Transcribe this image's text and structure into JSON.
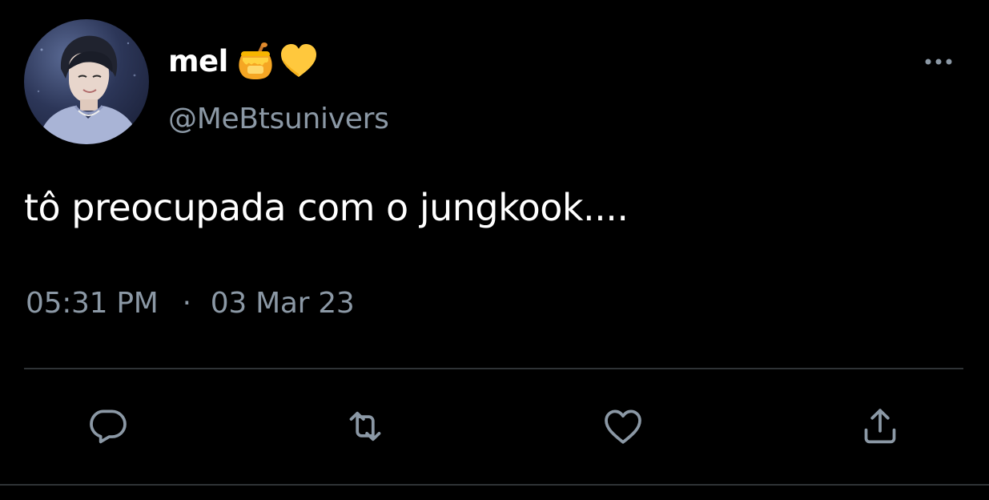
{
  "tweet": {
    "author": {
      "display_name": "mel",
      "name_emojis": [
        "honey-pot-icon",
        "yellow-heart-icon"
      ],
      "username": "@MeBtsunivers",
      "avatar": "profile-photo"
    },
    "text": "tô preocupada com o jungkook....",
    "time": "05:31 PM",
    "separator": "·",
    "date": "03 Mar 23",
    "actions": [
      "reply-icon",
      "retweet-icon",
      "like-icon",
      "share-icon"
    ],
    "more_menu_icon": "more-horizontal-icon"
  },
  "colors": {
    "background": "#000000",
    "primary_text": "#ffffff",
    "secondary_text": "#8b98a5",
    "divider": "#2f3336",
    "honey": "#f4b400",
    "heart": "#ffcc2e"
  }
}
